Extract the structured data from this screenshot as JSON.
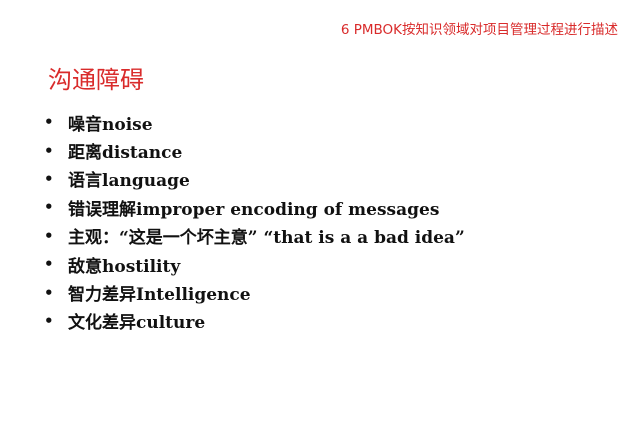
{
  "header": {
    "caption": "6  PMBOK按知识领域对项目管理过程进行描述"
  },
  "title": "沟通障碍",
  "bullets": [
    {
      "symbol": "•",
      "text": "噪音noise"
    },
    {
      "symbol": "•",
      "text": "距离distance"
    },
    {
      "symbol": "•",
      "text": "语言language"
    },
    {
      "symbol": "•",
      "text": "错误理解improper encoding of messages"
    },
    {
      "symbol": "•",
      "text": "主观：“这是一个坏主意”  “that is a a bad idea”"
    },
    {
      "symbol": "•",
      "text": "敌意hostility"
    },
    {
      "symbol": "•",
      "text": "智力差异Intelligence"
    },
    {
      "symbol": "•",
      "text": "文化差异culture"
    }
  ],
  "colors": {
    "accent": "#d92b2b",
    "text": "#111111",
    "background": "#ffffff"
  }
}
